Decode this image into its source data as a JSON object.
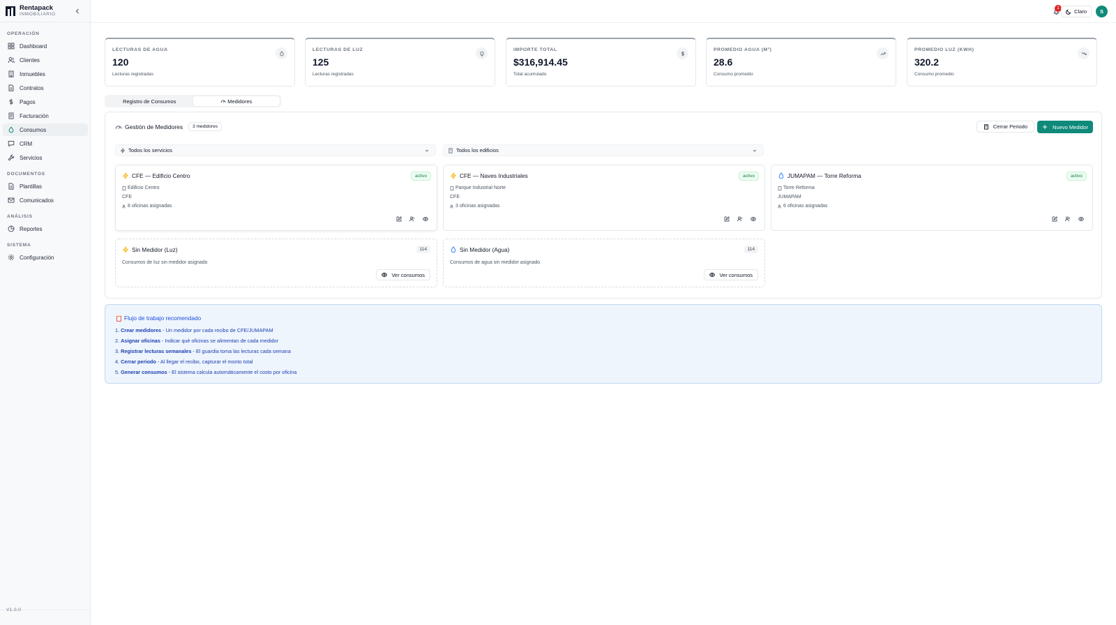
{
  "brand": {
    "name": "Rentapack",
    "subtitle": "INMOBILIARIO"
  },
  "sidebar": {
    "sections": [
      {
        "title": "OPERACIÓN",
        "items": [
          {
            "label": "Dashboard",
            "icon": "dashboard-icon"
          },
          {
            "label": "Clientes",
            "icon": "users-icon"
          },
          {
            "label": "Inmuebles",
            "icon": "building-icon"
          },
          {
            "label": "Contratos",
            "icon": "document-icon"
          },
          {
            "label": "Pagos",
            "icon": "dollar-icon"
          },
          {
            "label": "Facturación",
            "icon": "receipt-icon"
          },
          {
            "label": "Consumos",
            "icon": "gauge-icon",
            "active": true
          },
          {
            "label": "CRM",
            "icon": "chat-icon"
          },
          {
            "label": "Servicios",
            "icon": "wrench-icon"
          }
        ]
      },
      {
        "title": "DOCUMENTOS",
        "items": [
          {
            "label": "Plantillas",
            "icon": "document-icon"
          },
          {
            "label": "Comunicados",
            "icon": "mail-icon"
          }
        ]
      },
      {
        "title": "ANÁLISIS",
        "items": [
          {
            "label": "Reportes",
            "icon": "pie-chart-icon"
          }
        ]
      },
      {
        "title": "SISTEMA",
        "items": [
          {
            "label": "Configuración",
            "icon": "gear-icon"
          }
        ]
      }
    ],
    "version": "V1.0.0"
  },
  "topbar": {
    "notifications": "1",
    "theme_label": "Claro",
    "avatar_initial": "S"
  },
  "stats": [
    {
      "label": "LECTURAS DE AGUA",
      "value": "120",
      "sub": "Lecturas registradas",
      "icon": "droplet-icon"
    },
    {
      "label": "LECTURAS DE LUZ",
      "value": "125",
      "sub": "Lecturas registradas",
      "icon": "bulb-icon"
    },
    {
      "label": "IMPORTE TOTAL",
      "value": "$316,914.45",
      "sub": "Total acumulado",
      "icon": "dollar-icon"
    },
    {
      "label": "PROMEDIO AGUA (M³)",
      "value": "28.6",
      "sub": "Consumo promedio",
      "icon": "trend-up-icon"
    },
    {
      "label": "PROMEDIO LUZ (KWH)",
      "value": "320.2",
      "sub": "Consumo promedio",
      "icon": "trend-down-icon"
    }
  ],
  "tabs": [
    {
      "label": "Registro de Consumos"
    },
    {
      "label": "Medidores"
    }
  ],
  "panel": {
    "title": "Gestión de Medidores",
    "count": "3 medidores",
    "close_period": "Cerrar Periodo",
    "new_meter": "Nuevo Medidor",
    "filter_service": "Todos los servicios",
    "filter_building": "Todos los edificios"
  },
  "meters": [
    {
      "name": "CFE — Edificio Centro",
      "status": "activo",
      "building": "Edificio Centro",
      "provider": "CFE",
      "offices": "8 oficinas asignadas",
      "type": "luz"
    },
    {
      "name": "CFE — Naves Industriales",
      "status": "activo",
      "building": "Parque Industrial Norte",
      "provider": "CFE",
      "offices": "3 oficinas asignadas",
      "type": "luz"
    },
    {
      "name": "JUMAPAM — Torre Reforma",
      "status": "activo",
      "building": "Torre Reforma",
      "provider": "JUMAPAM",
      "offices": "6 oficinas asignadas",
      "type": "agua"
    }
  ],
  "unmetered": [
    {
      "title": "Sin Medidor (Luz)",
      "count": "114",
      "desc": "Consumos de luz sin medidor asignado",
      "button": "Ver consumos"
    },
    {
      "title": "Sin Medidor (Agua)",
      "count": "114",
      "desc": "Consumos de agua sin medidor asignado",
      "button": "Ver consumos"
    }
  ],
  "workflow": {
    "title": "Flujo de trabajo recomendado",
    "steps": [
      {
        "num": "1.",
        "bold": "Crear medidores",
        "text": " - Un medidor por cada recibo de CFE/JUMAPAM"
      },
      {
        "num": "2.",
        "bold": "Asignar oficinas",
        "text": " - Indicar qué oficinas se alimentan de cada medidor"
      },
      {
        "num": "3.",
        "bold": "Registrar lecturas semanales",
        "text": " - El guardia toma las lecturas cada semana"
      },
      {
        "num": "4.",
        "bold": "Cerrar periodo",
        "text": " - Al llegar el recibo, capturar el monto total"
      },
      {
        "num": "5.",
        "bold": "Generar consumos",
        "text": " - El sistema calcula automáticamente el costo por oficina"
      }
    ]
  },
  "colors": {
    "accent": "#0f8a7a",
    "bolt": "#f5b301",
    "water": "#3b82f6",
    "info_text": "#1e40af"
  }
}
